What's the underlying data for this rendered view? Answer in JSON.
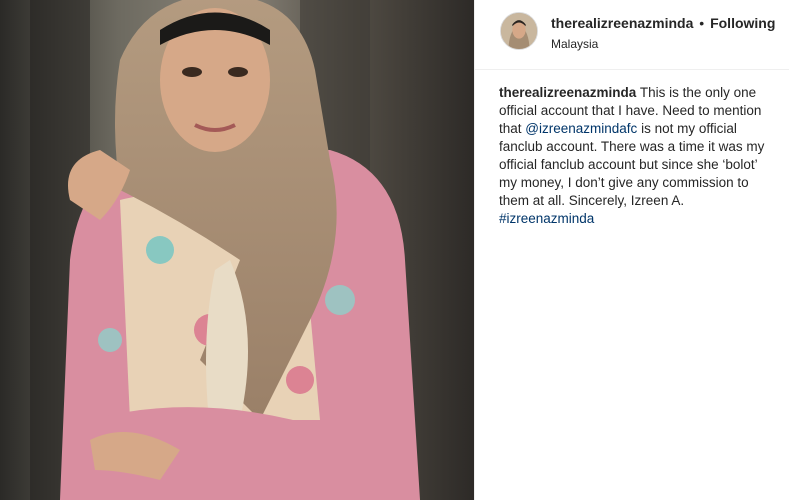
{
  "post": {
    "username": "therealizreenazminda",
    "separator": "•",
    "follow_status": "Following",
    "location": "Malaysia",
    "caption": {
      "username": "therealizreenazminda",
      "text_before_mention": "This is the only one official account that I have. Need to mention that",
      "mention": "@izreenazmindafc",
      "text_after_mention": "is not my official fanclub account. There was a time it was my official fanclub account but since she ‘bolot’ my money, I don’t give any commission to them at all. Sincerely, Izreen A.",
      "hashtag": "#izreenazminda"
    }
  },
  "colors": {
    "text": "#262626",
    "link": "#003569",
    "divider": "#efefef"
  },
  "icons": {
    "avatar": "profile-avatar",
    "photo": "post-photo"
  }
}
